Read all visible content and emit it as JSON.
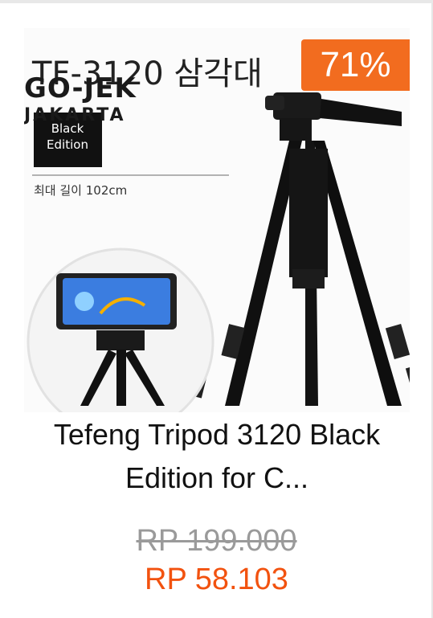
{
  "badge": {
    "discount": "71%"
  },
  "product": {
    "title_line1": "Tefeng Tripod 3120 Black",
    "title_line2": "Edition for C...",
    "price_original": "RP 199.000",
    "price_sale": "RP 58.103"
  },
  "image": {
    "model_text": "TF-3120 삼각대",
    "edition_line1": "Black",
    "edition_line2": "Edition",
    "length_text": "최대 길이 102cm",
    "watermark_main": "GO-JEK",
    "watermark_sub": "JAKARTA"
  },
  "colors": {
    "badge_bg": "#f26c1f",
    "sale_price": "#f2520f",
    "original_price": "#9a9a9a"
  }
}
